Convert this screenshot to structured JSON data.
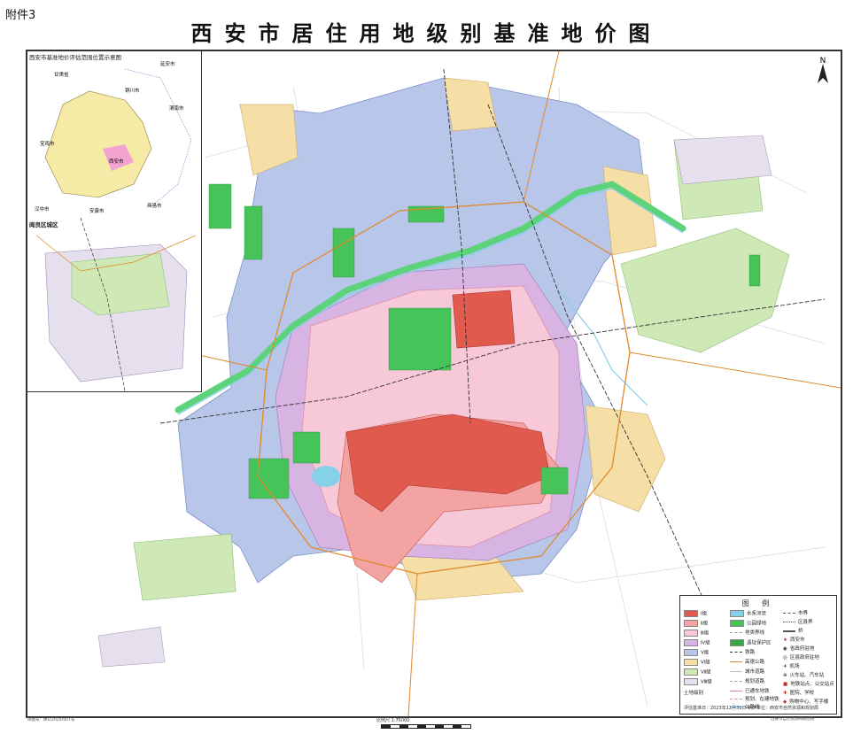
{
  "header": {
    "attachment_label": "附件3",
    "title": "西安市居住用地级别基准地价图"
  },
  "insets": {
    "location_title": "西安市基准地价评估范围位置示意图",
    "location_labels": [
      "甘肃省",
      "延安市",
      "铜川市",
      "渭南市",
      "宝鸡市",
      "西安市",
      "汉中市",
      "安康市",
      "商洛市"
    ],
    "district_title": "阎良区城区"
  },
  "north_arrow": {
    "label": "N"
  },
  "legend": {
    "title": "图 例",
    "grades": [
      {
        "label": "Ⅰ级",
        "color": "#e05a4e"
      },
      {
        "label": "Ⅱ级",
        "color": "#f3a3a1"
      },
      {
        "label": "Ⅲ级",
        "color": "#f7c8d8"
      },
      {
        "label": "Ⅳ级",
        "color": "#d8b4e2"
      },
      {
        "label": "Ⅴ级",
        "color": "#b8c6ea"
      },
      {
        "label": "Ⅵ级",
        "color": "#f5dfa6"
      },
      {
        "label": "Ⅶ级",
        "color": "#cfe9b6"
      },
      {
        "label": "Ⅷ级",
        "color": "#e6e0ee"
      }
    ],
    "features": [
      {
        "label": "水系河流",
        "color": "#86d0e8"
      },
      {
        "label": "公园绿地",
        "color": "#46c45a"
      },
      {
        "label": "地类界线",
        "color": "#999999"
      },
      {
        "label": "遗址保护区",
        "color": "#3aa64a"
      },
      {
        "label": "铁路",
        "color": "#333333"
      },
      {
        "label": "高速公路",
        "color": "#e08a2a"
      },
      {
        "label": "城市道路",
        "color": "#bbbbbb"
      },
      {
        "label": "规划道路",
        "color": "#aaaaaa"
      },
      {
        "label": "已通车地铁",
        "color": "#e07ab8"
      },
      {
        "label": "规划、在建地铁",
        "color": "#e07ab8"
      },
      {
        "label": "公路线",
        "color": "#6ab0e8"
      }
    ],
    "symbols": [
      "市界",
      "区县界",
      "桥",
      "西安市",
      "省政府驻地",
      "区县政府驻地",
      "机场",
      "火车站、汽车站",
      "地铁站点、公交站点",
      "医院、学校",
      "购物中心、写字楼"
    ],
    "note_label": "土地级别",
    "footer": "评估基准日：2023年12月31日    制作单位：西安市自然资源和规划局"
  },
  "scale": {
    "text": "比例尺 1:75000"
  },
  "footer": {
    "left_note": "审图号：陕S(2024)007号",
    "right_note": "西安市自然资源和规划局"
  }
}
